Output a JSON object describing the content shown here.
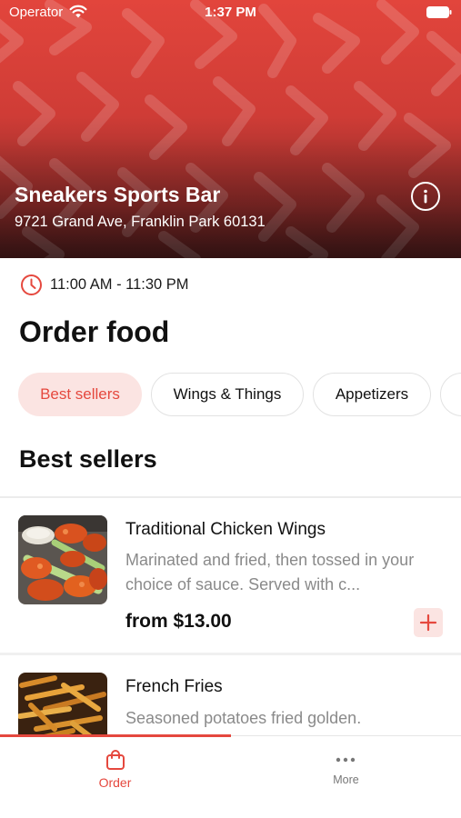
{
  "status_bar": {
    "carrier": "Operator",
    "time": "1:37 PM",
    "wifi_icon": "wifi-icon",
    "battery_icon": "battery-icon"
  },
  "restaurant": {
    "name": "Sneakers Sports Bar",
    "address": "9721 Grand Ave, Franklin Park 60131",
    "info_icon": "info-icon",
    "hours": "11:00 AM - 11:30 PM",
    "clock_icon": "clock-icon"
  },
  "page": {
    "title": "Order food"
  },
  "categories": [
    {
      "label": "Best sellers",
      "active": true
    },
    {
      "label": "Wings & Things",
      "active": false
    },
    {
      "label": "Appetizers",
      "active": false
    },
    {
      "label": "",
      "active": false
    }
  ],
  "section": {
    "title": "Best sellers"
  },
  "items": [
    {
      "name": "Traditional Chicken Wings",
      "description": "Marinated and fried, then tossed in your choice of sauce. Served with c...",
      "price": "from $13.00",
      "image": "chicken-wings-photo"
    },
    {
      "name": "French Fries",
      "description": "Seasoned potatoes fried golden.",
      "image": "french-fries-photo"
    }
  ],
  "tabbar": {
    "tabs": [
      {
        "label": "Order",
        "icon": "shopping-bag-icon",
        "active": true
      },
      {
        "label": "More",
        "icon": "more-dots-icon",
        "active": false
      }
    ]
  },
  "colors": {
    "accent": "#e5483e",
    "accent_light": "#fbe4e2",
    "hero_red": "#d8413a",
    "text_secondary": "#8a8a8a"
  }
}
